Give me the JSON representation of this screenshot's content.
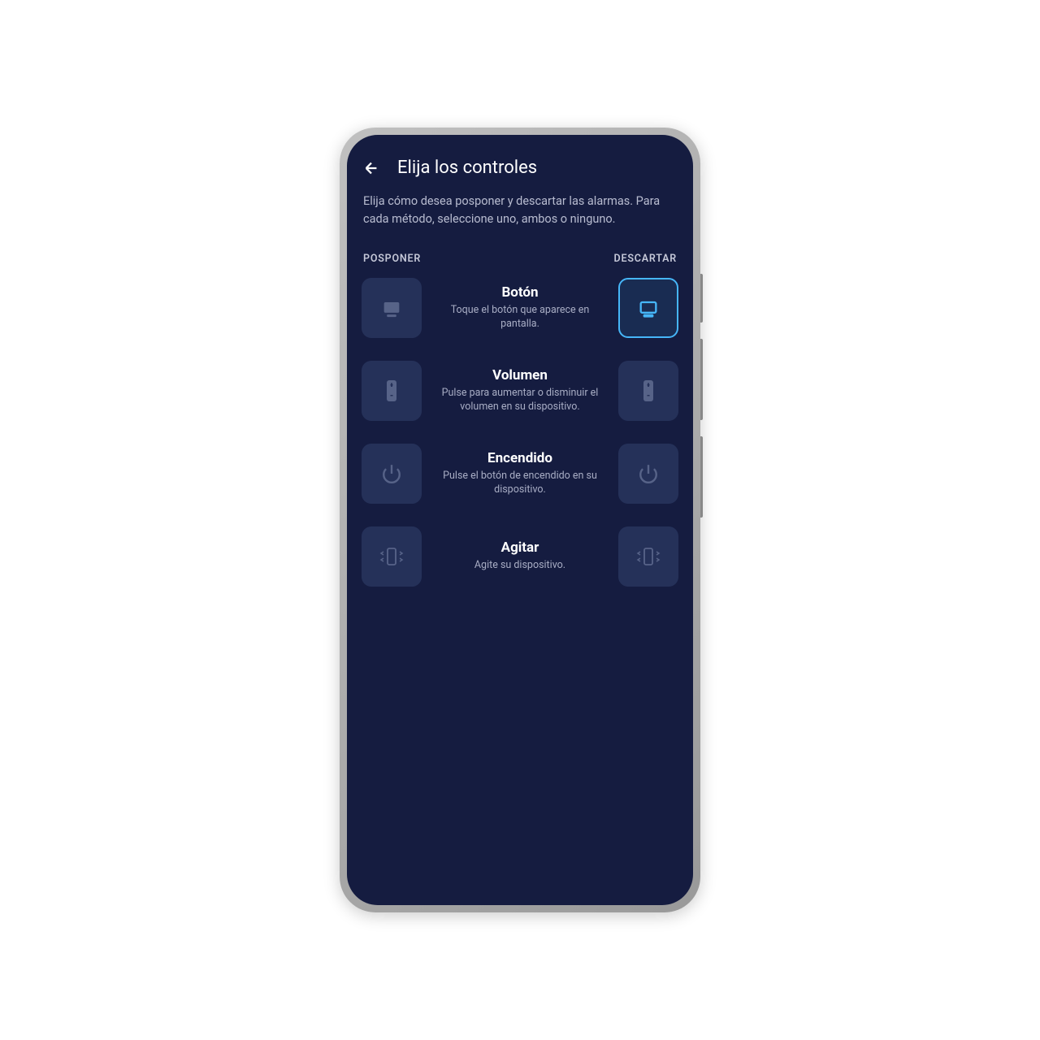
{
  "header": {
    "title": "Elija los controles"
  },
  "description": "Elija cómo desea posponer y descartar las alarmas. Para cada método, seleccione uno, ambos o ninguno.",
  "columns": {
    "left": "POSPONER",
    "right": "DESCARTAR"
  },
  "controls": [
    {
      "icon": "button-icon",
      "title": "Botón",
      "desc": "Toque el botón que aparece en pantalla.",
      "left_selected": false,
      "right_selected": true
    },
    {
      "icon": "volume-icon",
      "title": "Volumen",
      "desc": "Pulse para aumentar o disminuir el volumen en su dispositivo.",
      "left_selected": false,
      "right_selected": false
    },
    {
      "icon": "power-icon",
      "title": "Encendido",
      "desc": "Pulse el botón de encendido en su dispositivo.",
      "left_selected": false,
      "right_selected": false
    },
    {
      "icon": "shake-icon",
      "title": "Agitar",
      "desc": "Agite su dispositivo.",
      "left_selected": false,
      "right_selected": false
    }
  ],
  "colors": {
    "background": "#151c40",
    "button_inactive": "#253159",
    "accent": "#46b6f8",
    "text_primary": "#ffffff",
    "text_secondary": "#a8adc4"
  }
}
